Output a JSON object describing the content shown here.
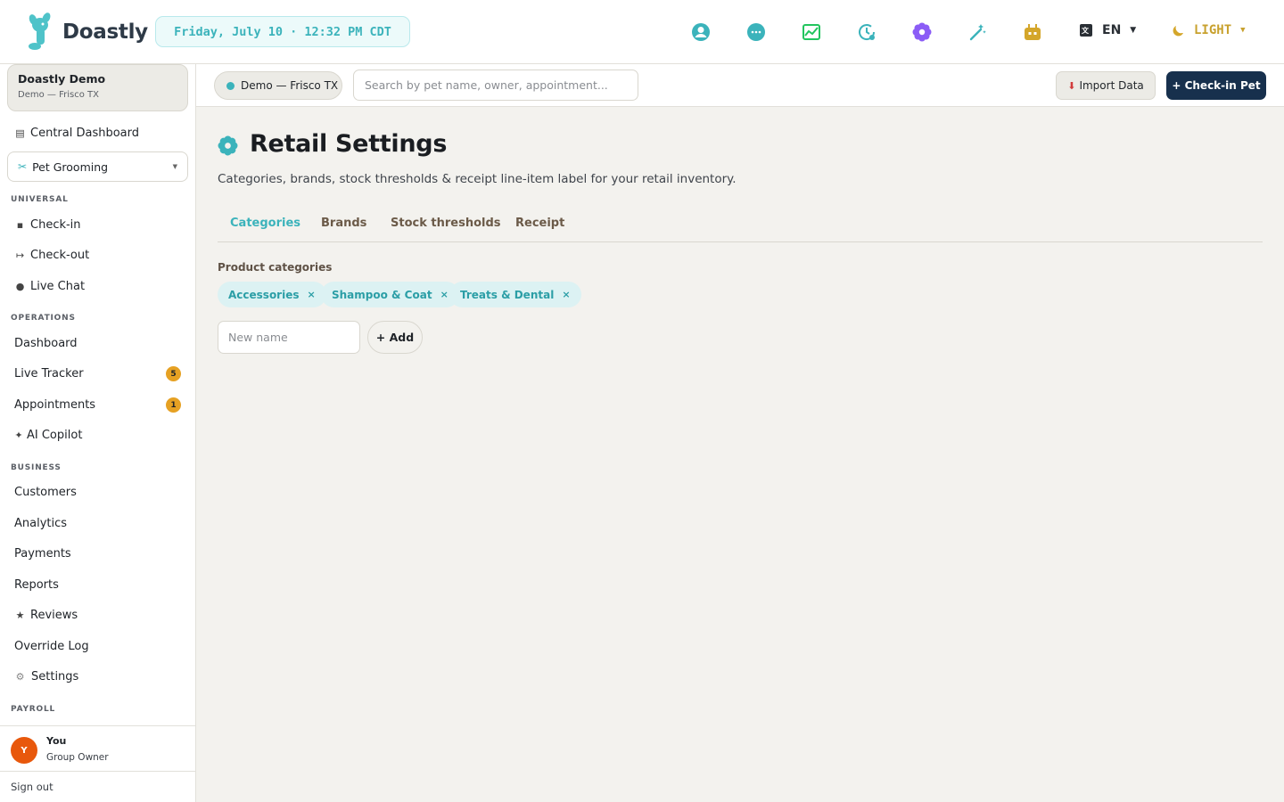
{
  "app": {
    "name": "Doastly",
    "datetime": "Friday, July 10 · 12:32 PM CDT"
  },
  "topbar": {
    "icons": [
      "user-circle-icon",
      "chat-bubble-icon",
      "chart-line-icon",
      "clock-history-icon",
      "flower-settings-icon",
      "magic-wand-icon",
      "robot-icon"
    ],
    "language": "EN",
    "theme": "LIGHT"
  },
  "sidebar": {
    "org": {
      "name": "Doastly Demo",
      "location": "Demo — Frisco TX"
    },
    "central_dashboard": "Central Dashboard",
    "service_select": "Pet Grooming",
    "sections": {
      "universal": "UNIVERSAL",
      "operations": "OPERATIONS",
      "business": "BUSINESS",
      "payroll": "PAYROLL"
    },
    "universal_items": [
      "Check-in",
      "Check-out",
      "Live Chat"
    ],
    "operations_items": [
      "Dashboard",
      "Live Tracker",
      "Appointments",
      "AI Copilot"
    ],
    "business_items": [
      "Customers",
      "Analytics",
      "Payments",
      "Reports",
      "Reviews",
      "Override Log",
      "Settings"
    ],
    "badges": {
      "live_tracker": "5",
      "appointments": "1"
    },
    "user": {
      "initial": "Y",
      "name": "You",
      "role": "Group Owner"
    },
    "sign_out": "Sign out"
  },
  "subbar": {
    "location": "Demo — Frisco TX",
    "search_placeholder": "Search by pet name, owner, appointment...",
    "import_label": "Import Data",
    "checkin_label": "+ Check-in Pet"
  },
  "main": {
    "title": "Retail Settings",
    "description": "Categories, brands, stock thresholds & receipt line-item label for your retail inventory.",
    "tabs": [
      "Categories",
      "Brands",
      "Stock thresholds",
      "Receipt"
    ],
    "active_tab": "Categories",
    "categories_label": "Product categories",
    "categories": [
      "Accessories",
      "Shampoo & Coat",
      "Treats & Dental"
    ],
    "new_name_placeholder": "New name",
    "add_label": "+ Add"
  },
  "colors": {
    "accent": "#3bb3bb",
    "primary_button": "#17304d",
    "badge": "#e6a123",
    "avatar": "#e8580c"
  }
}
